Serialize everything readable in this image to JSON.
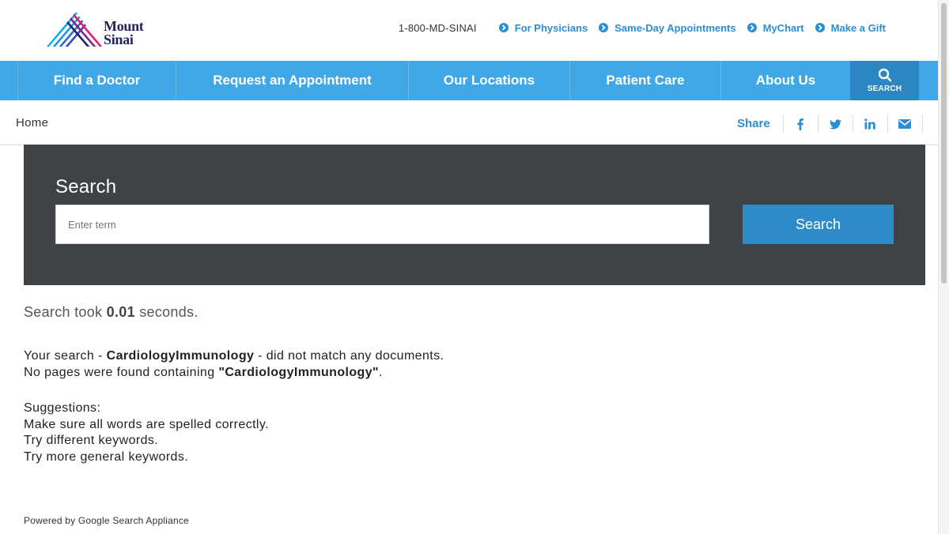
{
  "brand": {
    "logo_line1": "Mount",
    "logo_line2": "Sinai",
    "colors": {
      "pink": "#e31c79",
      "blue": "#00aeef",
      "navy": "#221f72"
    }
  },
  "utility": {
    "phone": "1-800-MD-SINAI",
    "links": [
      "For Physicians",
      "Same-Day Appointments",
      "MyChart",
      "Make a Gift"
    ],
    "link_icon": "chevron-circle-right-icon"
  },
  "nav": {
    "items": [
      "Find a Doctor",
      "Request an Appointment",
      "Our Locations",
      "Patient Care",
      "About Us"
    ],
    "search_label": "SEARCH",
    "search_icon": "search-icon",
    "bg_color": "#41a8e7"
  },
  "breadcrumb": {
    "home": "Home"
  },
  "share": {
    "label": "Share",
    "icons": [
      "facebook-icon",
      "twitter-icon",
      "linkedin-icon",
      "email-icon"
    ]
  },
  "search": {
    "title": "Search",
    "input_value": "",
    "input_placeholder": "Enter term",
    "button_label": "Search",
    "panel_color": "#3f4247",
    "button_color": "#2f8bc8"
  },
  "results": {
    "took_prefix": "Search took ",
    "took_value": "0.01",
    "took_suffix": " seconds.",
    "nomatch_prefix": "Your search - ",
    "query": "CardiologyImmunology",
    "nomatch_suffix": " - did not match any documents.",
    "nopages_prefix": "No pages were found containing ",
    "nopages_query": "\"CardiologyImmunology\"",
    "nopages_suffix": ".",
    "suggestions_title": "Suggestions:",
    "suggestions": [
      "Make sure all words are spelled correctly.",
      "Try different keywords.",
      "Try more general keywords."
    ]
  },
  "footer": {
    "powered_by": "Powered by Google Search Appliance"
  }
}
